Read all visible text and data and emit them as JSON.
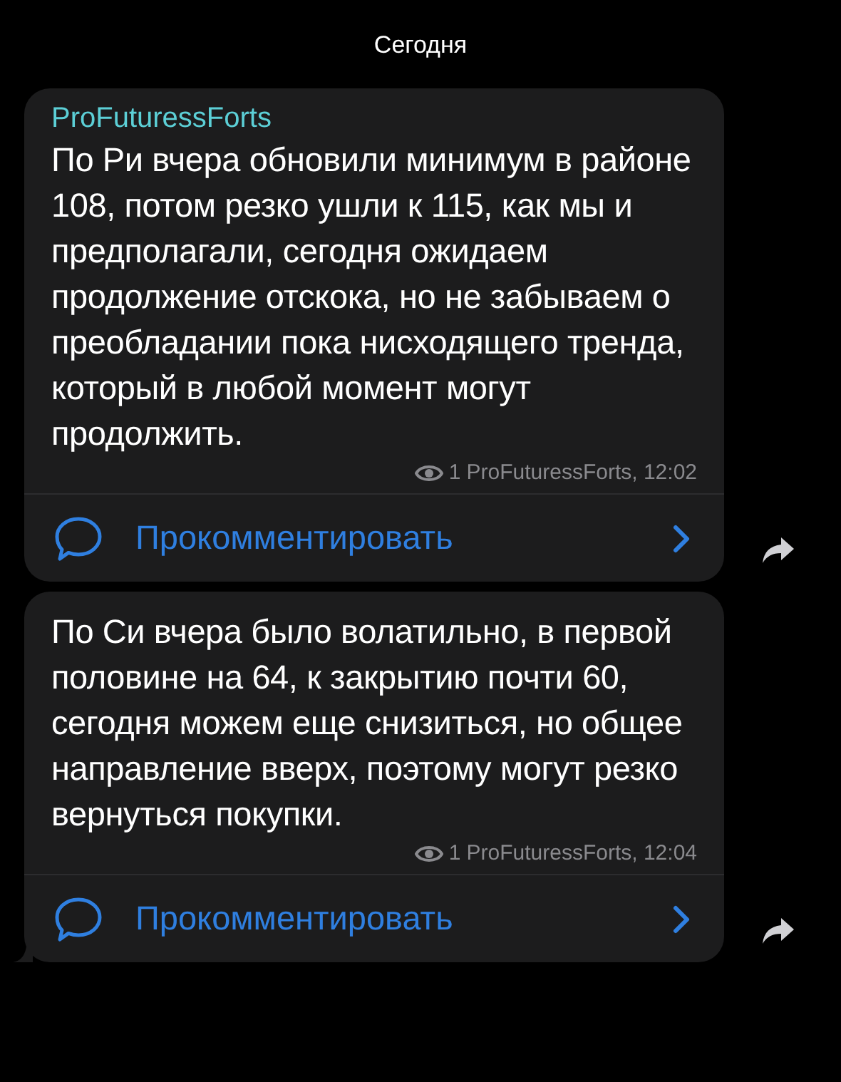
{
  "date_header": "Сегодня",
  "messages": [
    {
      "author": "ProFuturessForts",
      "text": "По Ри вчера обновили минимум в районе 108, потом резко ушли к 115, как мы и предполагали, сегодня ожидаем продолжение отскока, но не забываем о преобладании пока нисходящего тренда, который в любой момент могут продолжить.",
      "views": "1",
      "signature": "ProFuturessForts, 12:02",
      "comment_label": "Прокомментировать",
      "tail": false
    },
    {
      "text": "По Си вчера было волатильно, в первой половине на 64, к закрытию почти 60, сегодня можем еще снизиться, но общее направление вверх, поэтому могут резко вернуться покупки.",
      "views": "1",
      "signature": "ProFuturessForts, 12:04",
      "comment_label": "Прокомментировать",
      "tail": true
    }
  ]
}
